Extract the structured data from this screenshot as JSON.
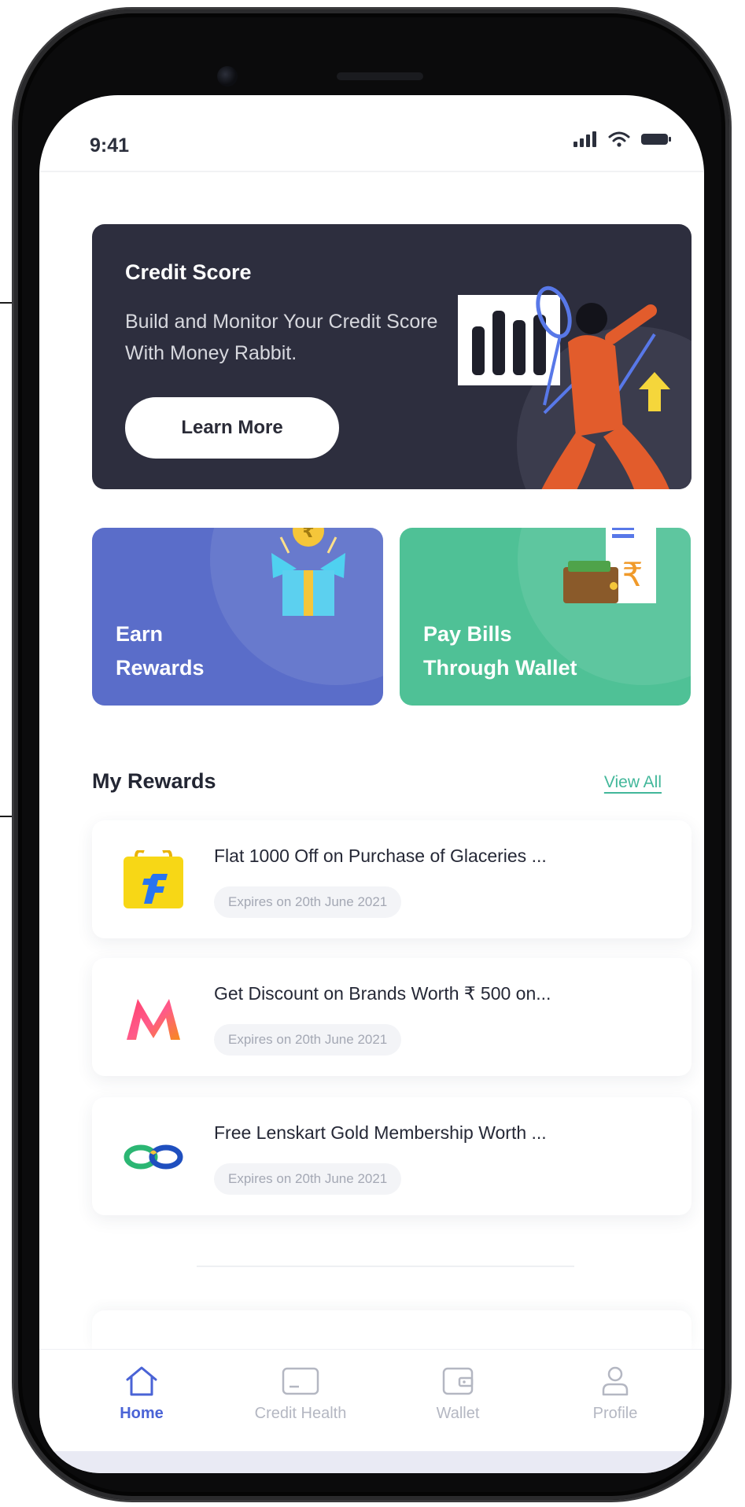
{
  "status_bar": {
    "time": "9:41"
  },
  "credit_card": {
    "title": "Credit Score",
    "description": "Build and Monitor Your Credit Score With Money Rabbit.",
    "button_label": "Learn More"
  },
  "quick_actions": [
    {
      "line1": "Earn",
      "line2": "Rewards",
      "icon": "gift-box-icon",
      "color": "#5a6dc9"
    },
    {
      "line1": "Pay Bills",
      "line2": "Through Wallet",
      "icon": "wallet-bill-icon",
      "color": "#4fc196"
    }
  ],
  "rewards_section": {
    "title": "My Rewards",
    "view_all": "View All"
  },
  "rewards": [
    {
      "title": "Flat 1000 Off on Purchase of Glaceries ...",
      "expiry": "Expires on 20th June 2021",
      "logo": "flipkart-logo-icon"
    },
    {
      "title": "Get Discount on Brands Worth ₹ 500 on...",
      "expiry": "Expires on 20th June 2021",
      "logo": "myntra-logo-icon"
    },
    {
      "title": "Free Lenskart Gold Membership Worth ...",
      "expiry": "Expires on 20th June 2021",
      "logo": "lenskart-logo-icon"
    }
  ],
  "bottom_nav": [
    {
      "label": "Home",
      "icon": "home-icon",
      "active": true
    },
    {
      "label": "Credit Health",
      "icon": "credit-card-icon",
      "active": false
    },
    {
      "label": "Wallet",
      "icon": "wallet-icon",
      "active": false
    },
    {
      "label": "Profile",
      "icon": "user-icon",
      "active": false
    }
  ],
  "colors": {
    "primary": "#4a63d6",
    "accent_green": "#42b79a",
    "banner_dark": "#2d2e3e"
  }
}
